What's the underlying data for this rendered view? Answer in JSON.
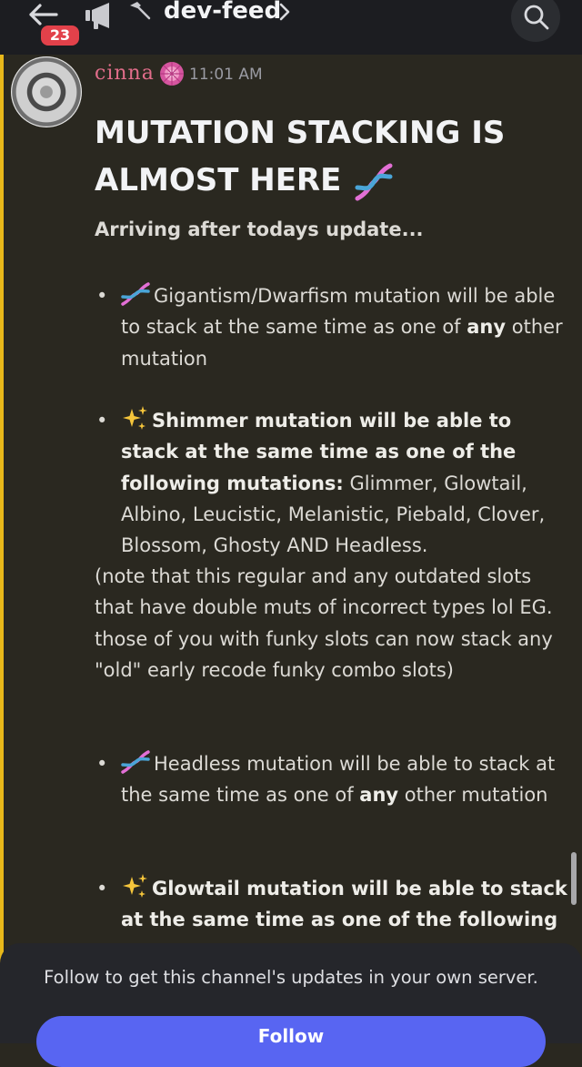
{
  "header": {
    "back_badge_count": "23",
    "channel_name": "dev-feed",
    "icons": [
      "back-arrow-icon",
      "megaphone-icon",
      "hammer-icon",
      "chevron-right-icon",
      "search-icon"
    ]
  },
  "message": {
    "author": "cinna",
    "author_badge_icon": "flower-badge-icon",
    "timestamp": "11:01 AM",
    "title": "MUTATION STACKING IS ALMOST HERE",
    "subtitle": "Arriving after todays update...",
    "bullets": [
      {
        "icon": "dna-icon",
        "pre": "Gigantism/Dwarfism mutation will be able to stack at the same time as one of ",
        "bold": "any",
        "post": " other mutation"
      },
      {
        "icon": "sparkles-icon",
        "bold": "Shimmer mutation will be able to stack at the same time as one of the following mutations:",
        "post": " Glimmer, Glowtail, Albino, Leucistic, Melanistic, Piebald, Clover, Blossom, Ghosty AND Headless."
      },
      {
        "icon": "dna-icon",
        "pre": "Headless mutation will be able to stack at the same time as one of ",
        "bold": "any",
        "post": " other mutation"
      },
      {
        "icon": "sparkles-icon",
        "bold": "Glowtail mutation will be able to stack at the same time as one of the following"
      }
    ],
    "note": "(note that this regular and any outdated slots that have double muts of incorrect types lol EG. those of you with funky slots can now stack any \"old\" early recode funky combo slots)"
  },
  "follow_panel": {
    "text": "Follow to get this channel's updates in your own server.",
    "button_label": "Follow"
  },
  "colors": {
    "background": "#2a2820",
    "accent_bar": "#e8b81a",
    "author": "#e16d8a",
    "follow_button": "#5865f2",
    "badge": "#e2414a"
  }
}
